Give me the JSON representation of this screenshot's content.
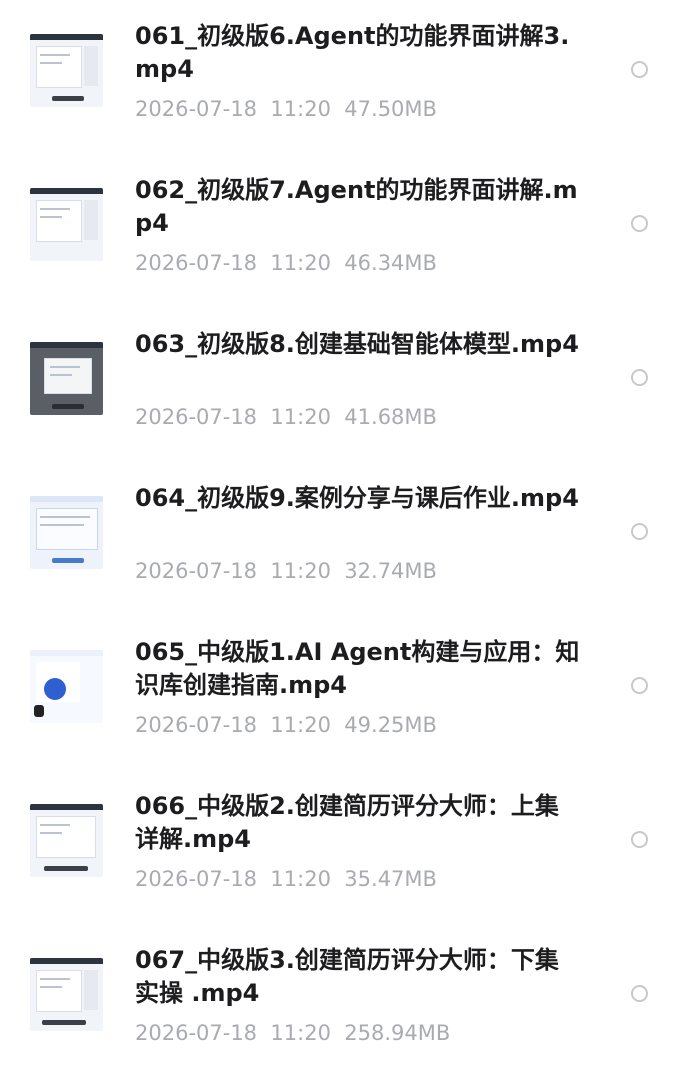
{
  "files": [
    {
      "name": "061_初级版6.Agent的功能界面讲解3.mp4",
      "date": "2026-07-18",
      "time": "11:20",
      "size": "47.50MB",
      "thumb_icon": "screenshot-thumbnail-icon"
    },
    {
      "name": "062_初级版7.Agent的功能界面讲解.mp4",
      "date": "2026-07-18",
      "time": "11:20",
      "size": "46.34MB",
      "thumb_icon": "screenshot-thumbnail-icon"
    },
    {
      "name": "063_初级版8.创建基础智能体模型.mp4",
      "date": "2026-07-18",
      "time": "11:20",
      "size": "41.68MB",
      "thumb_icon": "dialog-thumbnail-icon"
    },
    {
      "name": "064_初级版9.案例分享与课后作业.mp4",
      "date": "2026-07-18",
      "time": "11:20",
      "size": "32.74MB",
      "thumb_icon": "slide-thumbnail-icon"
    },
    {
      "name": "065_中级版1.AI Agent构建与应用：知识库创建指南.mp4",
      "date": "2026-07-18",
      "time": "11:20",
      "size": "49.25MB",
      "thumb_icon": "diagram-thumbnail-icon"
    },
    {
      "name": "066_中级版2.创建简历评分大师：上集详解.mp4",
      "date": "2026-07-18",
      "time": "11:20",
      "size": "35.47MB",
      "thumb_icon": "screenshot-thumbnail-icon"
    },
    {
      "name": "067_中级版3.创建简历评分大师：下集实操 .mp4",
      "date": "2026-07-18",
      "time": "11:20",
      "size": "258.94MB",
      "thumb_icon": "screenshot-thumbnail-icon"
    }
  ],
  "colors": {
    "title": "#1d1d1f",
    "meta": "#a9abb0",
    "radio_border": "#c8c8cc"
  }
}
